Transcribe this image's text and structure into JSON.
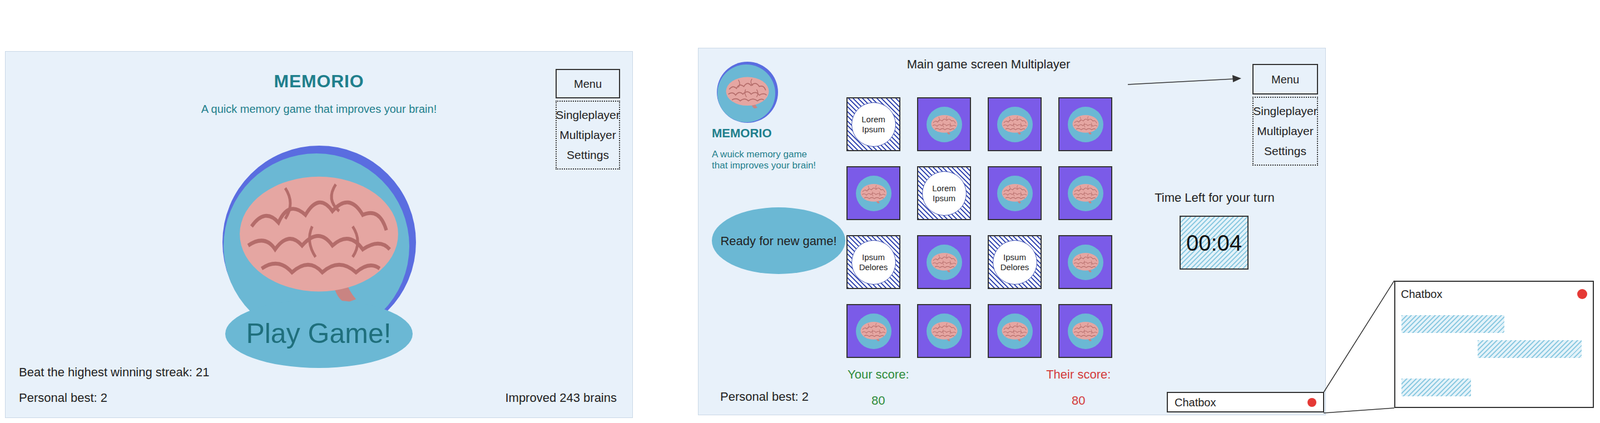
{
  "start_screen": {
    "title": "MEMORIO",
    "subtitle": "A quick memory game that improves your brain!",
    "play_button": "Play Game!",
    "menu": {
      "label": "Menu",
      "items": [
        "Singleplayer",
        "Multiplayer",
        "Settings"
      ]
    },
    "highest_streak": "Beat the highest winning streak: 21",
    "personal_best": "Personal best: 2",
    "brains_improved": "Improved 243 brains"
  },
  "game_screen": {
    "heading": "Main game screen Multiplayer",
    "logo_title": "MEMORIO",
    "logo_subtitle": [
      "A wuick memory game",
      "that improves your brain!"
    ],
    "new_game_button": "Ready for new game!",
    "menu": {
      "label": "Menu",
      "items": [
        "Singleplayer",
        "Multiplayer",
        "Settings"
      ]
    },
    "cards": [
      {
        "revealed": true,
        "label": "Lorem Ipsum"
      },
      {
        "revealed": false
      },
      {
        "revealed": false
      },
      {
        "revealed": false
      },
      {
        "revealed": false
      },
      {
        "revealed": true,
        "label": "Lorem Ipsum"
      },
      {
        "revealed": false
      },
      {
        "revealed": false
      },
      {
        "revealed": true,
        "label": "Ipsum Delores"
      },
      {
        "revealed": false
      },
      {
        "revealed": true,
        "label": "Ipsum Delores"
      },
      {
        "revealed": false
      },
      {
        "revealed": false
      },
      {
        "revealed": false
      },
      {
        "revealed": false
      },
      {
        "revealed": false
      }
    ],
    "timer": {
      "label": "Time Left for your turn",
      "value": "00:04"
    },
    "scores": {
      "yours": {
        "label": "Your score:",
        "value": "80"
      },
      "theirs": {
        "label": "Their score:",
        "value": "80"
      }
    },
    "personal_best": "Personal best: 2",
    "chatbox": {
      "label": "Chatbox"
    }
  },
  "chat_popup": {
    "title": "Chatbox",
    "messages": [
      {
        "kind": "received"
      },
      {
        "kind": "sent"
      },
      {
        "kind": "received"
      }
    ]
  }
}
